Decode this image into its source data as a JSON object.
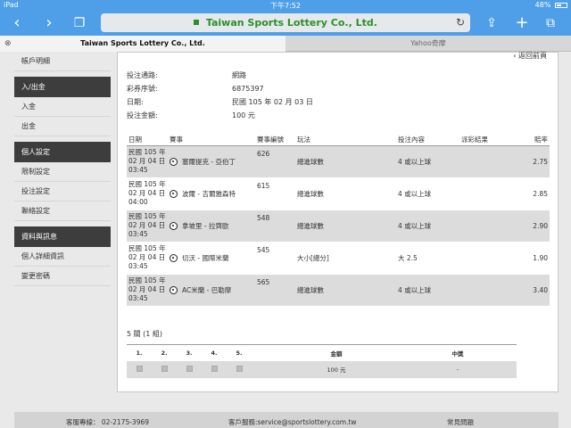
{
  "status": {
    "device": "iPad",
    "time": "下午7:52",
    "battery": "48%"
  },
  "browser": {
    "url_title": "Taiwan Sports Lottery Co., Ltd."
  },
  "tabs": [
    {
      "label": "Taiwan Sports Lottery Co., Ltd."
    },
    {
      "label": "Yahoo奇摩"
    }
  ],
  "sidebar": {
    "account_link": "帳戶明細",
    "groups": [
      {
        "title": "入/出金",
        "items": [
          "入金",
          "出金"
        ]
      },
      {
        "title": "個人設定",
        "items": [
          "限制設定",
          "投注設定",
          "聯絡設定"
        ]
      },
      {
        "title": "資料與訊息",
        "items": [
          "個人詳細資訊",
          "變更密碼"
        ]
      }
    ]
  },
  "content": {
    "back_link": "返回前頁",
    "info": [
      {
        "label": "投注通路:",
        "value": "網路"
      },
      {
        "label": "彩券序號:",
        "value": "6875397"
      },
      {
        "label": "日期:",
        "value": "民國 105 年 02 月 03 日"
      },
      {
        "label": "投注金額:",
        "value": "100 元"
      }
    ],
    "bet_columns": [
      "日期",
      "賽事",
      "賽事編號",
      "玩法",
      "投注內容",
      "派彩結果",
      "賠率"
    ],
    "bets": [
      {
        "date": [
          "民國 105 年",
          "02 月 04 日",
          "03:45"
        ],
        "match": "塞爾提克 - 亞伯丁",
        "code": "626",
        "play": "總進球數",
        "pick": "4 或以上球",
        "result": "",
        "odds": "2.75"
      },
      {
        "date": [
          "民國 105 年",
          "02 月 04 日",
          "04:00"
        ],
        "match": "波爾 - 吉爾雅森特",
        "code": "615",
        "play": "總進球數",
        "pick": "4 或以上球",
        "result": "",
        "odds": "2.85"
      },
      {
        "date": [
          "民國 105 年",
          "02 月 04 日",
          "03:45"
        ],
        "match": "拿坡里 - 拉齊歐",
        "code": "548",
        "play": "總進球數",
        "pick": "4 或以上球",
        "result": "",
        "odds": "2.90"
      },
      {
        "date": [
          "民國 105 年",
          "02 月 04 日",
          "03:45"
        ],
        "match": "切沃 - 國際米蘭",
        "code": "545",
        "play": "大小[總分]",
        "pick": "大 2.5",
        "result": "",
        "odds": "1.90"
      },
      {
        "date": [
          "民國 105 年",
          "02 月 04 日",
          "03:45"
        ],
        "match": "AC米蘭 - 巴勒摩",
        "code": "565",
        "play": "總進球數",
        "pick": "4 或以上球",
        "result": "",
        "odds": "3.40"
      }
    ],
    "summary": "5 關 (1 組)",
    "pay_columns": [
      "1.",
      "2.",
      "3.",
      "4.",
      "5.",
      "",
      "金額",
      "中獎"
    ],
    "pay_row": {
      "amount": "100 元",
      "win": "-"
    }
  },
  "footer": {
    "phone": "客服專線：  02-2175-3969",
    "email": "客戶服務:service@sportslottery.com.tw",
    "faq": "常見問題"
  }
}
